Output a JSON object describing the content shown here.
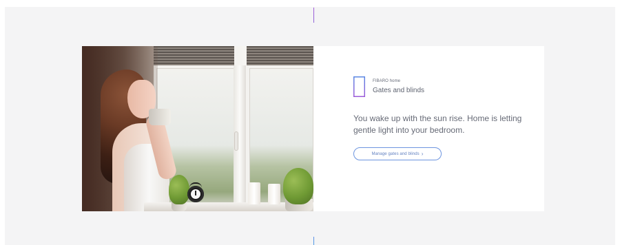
{
  "colors": {
    "accent_gradient_top": "#9c5bd9",
    "accent_gradient_bottom": "#4f9de6",
    "button_border": "#6c94df",
    "text": "#666a76",
    "background": "#f4f4f5"
  },
  "hero": {
    "image_icon": "bedroom-window-photo-icon"
  },
  "product": {
    "brand": "FIBARO home",
    "name": "Gates and blinds",
    "icon": "window-blinds-icon"
  },
  "content": {
    "headline": "You wake up with the sun rise. Home is letting gentle light into your bedroom."
  },
  "actions": {
    "manage_label": "Manage gates and blinds",
    "manage_icon": "chevron-right-icon"
  }
}
